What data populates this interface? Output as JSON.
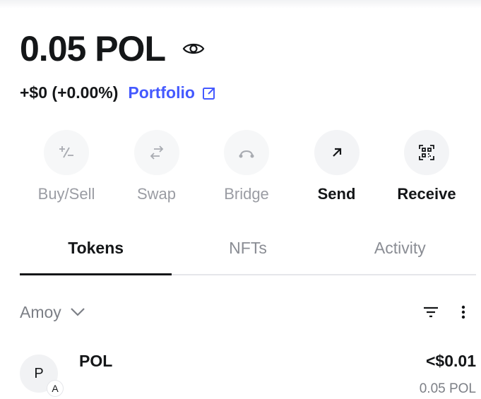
{
  "balance": {
    "amount": "0.05 POL"
  },
  "change": {
    "text": "+$0 (+0.00%)",
    "portfolio_label": "Portfolio"
  },
  "actions": [
    {
      "label": "Buy/Sell",
      "icon": "plus-minus-icon",
      "enabled": false
    },
    {
      "label": "Swap",
      "icon": "swap-arrows-icon",
      "enabled": false
    },
    {
      "label": "Bridge",
      "icon": "bridge-icon",
      "enabled": false
    },
    {
      "label": "Send",
      "icon": "arrow-up-right-icon",
      "enabled": true
    },
    {
      "label": "Receive",
      "icon": "qr-code-icon",
      "enabled": true
    }
  ],
  "tabs": [
    {
      "label": "Tokens",
      "active": true
    },
    {
      "label": "NFTs",
      "active": false
    },
    {
      "label": "Activity",
      "active": false
    }
  ],
  "network": {
    "label": "Amoy"
  },
  "tokens": [
    {
      "avatar": "P",
      "badge": "A",
      "name": "POL",
      "fiat": "<$0.01",
      "amount": "0.05 POL"
    }
  ],
  "colors": {
    "accent": "#4459ff",
    "text": "#141618",
    "muted": "#7c7f86",
    "circle_bg": "#f3f4f6"
  }
}
